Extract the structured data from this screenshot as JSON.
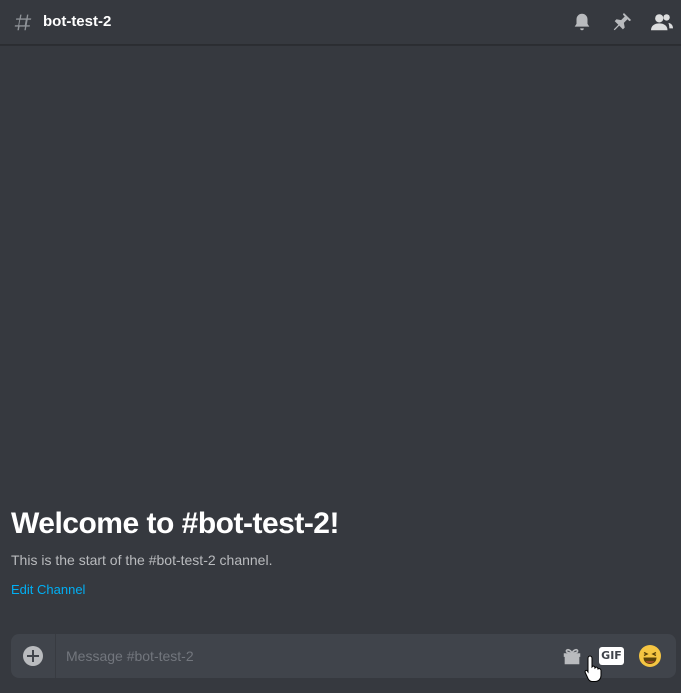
{
  "header": {
    "channel_name": "bot-test-2",
    "icons": [
      "hash-icon",
      "bell-icon",
      "pin-icon",
      "members-icon"
    ]
  },
  "welcome": {
    "title": "Welcome to #bot-test-2!",
    "subtitle": "This is the start of the #bot-test-2 channel.",
    "edit_link": "Edit Channel"
  },
  "composer": {
    "placeholder": "Message #bot-test-2",
    "gif_label": "GIF",
    "icons": [
      "add-icon",
      "gift-icon",
      "gif-icon",
      "emoji-icon"
    ]
  },
  "colors": {
    "background": "#36393f",
    "composer_bg": "#40444b",
    "link": "#00aff4",
    "text_muted": "#b9bbbe"
  }
}
